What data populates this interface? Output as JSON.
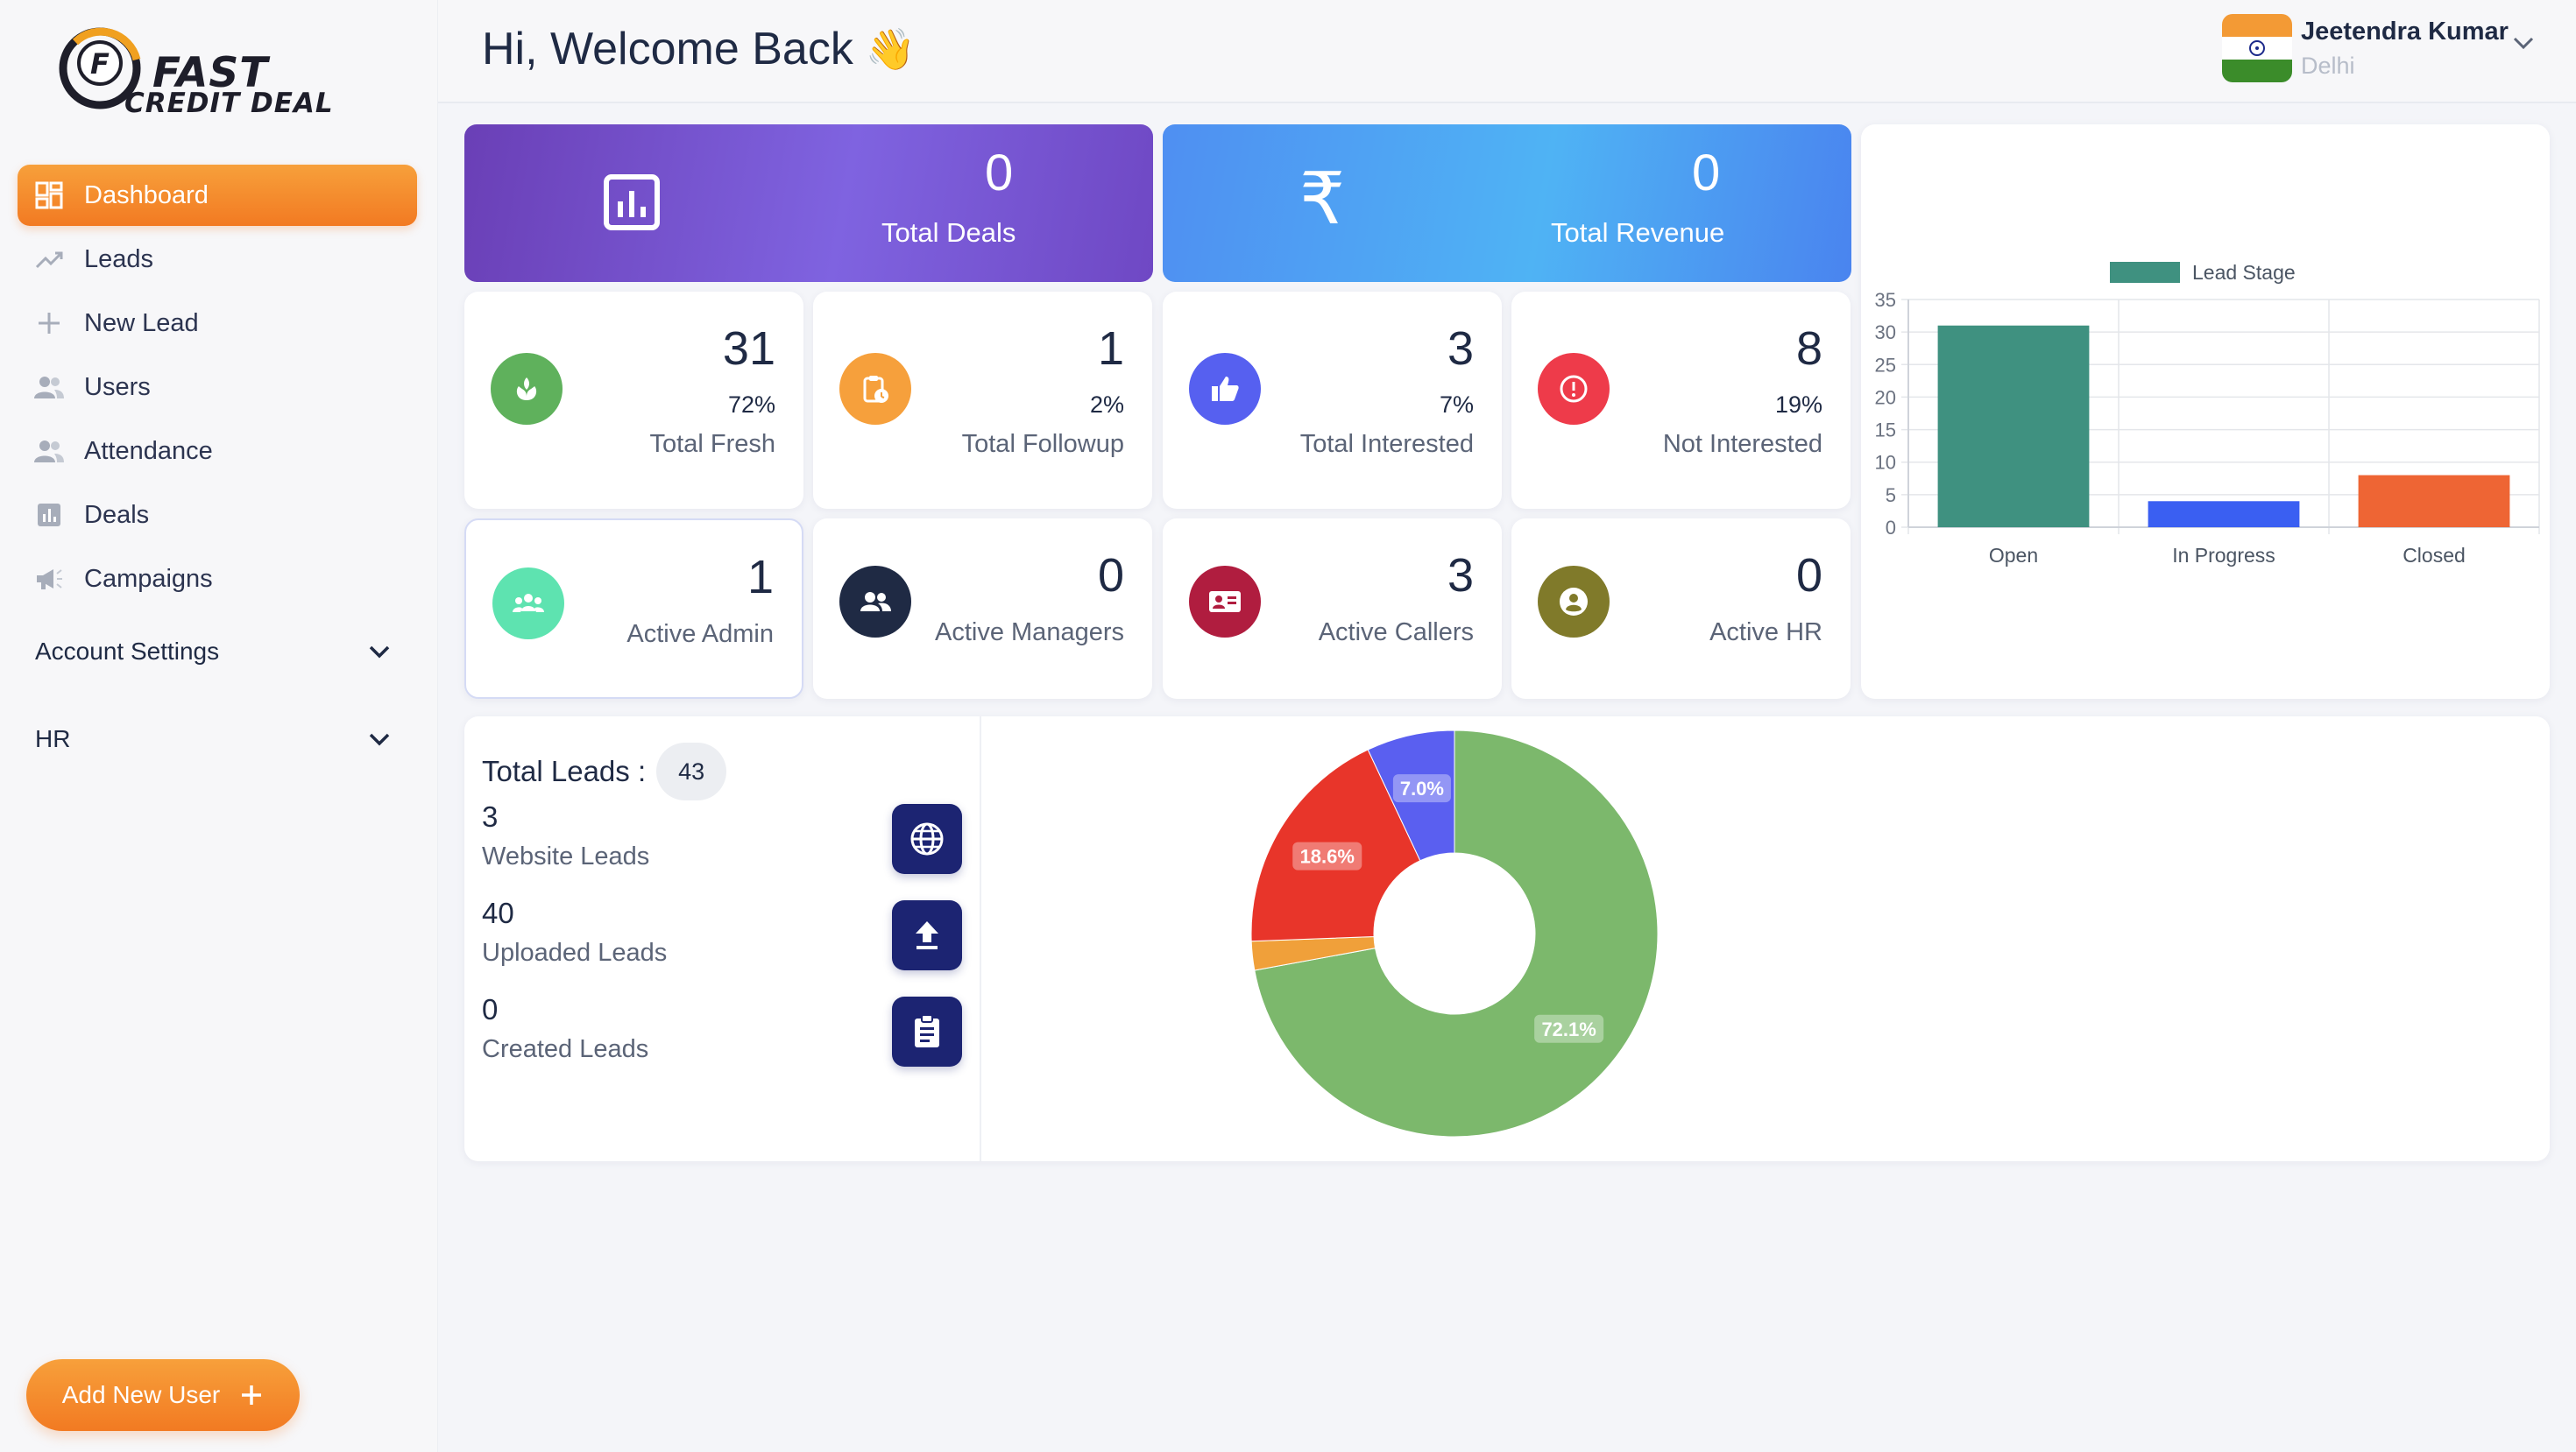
{
  "brand": {
    "logo_letter": "F",
    "line1": "FAST",
    "line2": "CREDIT DEAL"
  },
  "sidebar": {
    "items": [
      {
        "label": "Dashboard",
        "icon": "dashboard-icon",
        "active": true
      },
      {
        "label": "Leads",
        "icon": "trending-icon"
      },
      {
        "label": "New Lead",
        "icon": "plus-icon"
      },
      {
        "label": "Users",
        "icon": "users-icon"
      },
      {
        "label": "Attendance",
        "icon": "attendance-icon"
      },
      {
        "label": "Deals",
        "icon": "bar-chart-icon"
      },
      {
        "label": "Campaigns",
        "icon": "megaphone-icon"
      }
    ],
    "sections": [
      {
        "label": "Account Settings"
      },
      {
        "label": "HR"
      }
    ],
    "add_user_label": "Add New User"
  },
  "header": {
    "welcome": "Hi, Welcome Back",
    "wave_emoji": "👋",
    "user_name": "Jeetendra Kumar",
    "user_city": "Delhi"
  },
  "summary": {
    "deals": {
      "value": "0",
      "label": "Total Deals"
    },
    "revenue": {
      "value": "0",
      "label": "Total Revenue",
      "currency_symbol": "₹"
    }
  },
  "stats_row1": [
    {
      "value": "31",
      "pct": "72%",
      "label": "Total Fresh",
      "color": "#5fb15c",
      "icon": "sprout-icon"
    },
    {
      "value": "1",
      "pct": "2%",
      "label": "Total Followup",
      "color": "#f6a03c",
      "icon": "clipboard-clock-icon"
    },
    {
      "value": "3",
      "pct": "7%",
      "label": "Total Interested",
      "color": "#5660f0",
      "icon": "thumbs-up-icon"
    },
    {
      "value": "8",
      "pct": "19%",
      "label": "Not Interested",
      "color": "#ee3b4a",
      "icon": "alert-icon"
    }
  ],
  "stats_row2": [
    {
      "value": "1",
      "label": "Active Admin",
      "color": "#5ee3b0",
      "icon": "group-icon"
    },
    {
      "value": "0",
      "label": "Active Managers",
      "color": "#1f2a44",
      "icon": "people-icon"
    },
    {
      "value": "3",
      "label": "Active Callers",
      "color": "#b01d3f",
      "icon": "contact-card-icon"
    },
    {
      "value": "0",
      "label": "Active HR",
      "color": "#807a2a",
      "icon": "account-circle-icon"
    }
  ],
  "bar_chart": {
    "chart_data": {
      "type": "bar",
      "categories": [
        "Open",
        "In Progress",
        "Closed"
      ],
      "series": [
        {
          "name": "Lead Stage",
          "values": [
            31,
            4,
            8
          ]
        }
      ],
      "bar_colors": [
        "#3f9180",
        "#3a5ff2",
        "#ee6534"
      ],
      "ylim": [
        0,
        35
      ],
      "yticks": [
        "0",
        "5",
        "10",
        "15",
        "20",
        "25",
        "30",
        "35"
      ],
      "grid": true,
      "legend": "top"
    }
  },
  "leads": {
    "title": "Total Leads :",
    "total": "43",
    "rows": [
      {
        "value": "3",
        "label": "Website Leads",
        "icon": "globe-icon"
      },
      {
        "value": "40",
        "label": "Uploaded Leads",
        "icon": "upload-icon"
      },
      {
        "value": "0",
        "label": "Created Leads",
        "icon": "clipboard-icon"
      }
    ]
  },
  "donut_chart": {
    "chart_data": {
      "type": "pie",
      "values": [
        72.1,
        2.3,
        18.6,
        7.0
      ],
      "labels": [
        "72.1%",
        "",
        "18.6%",
        "7.0%"
      ],
      "colors": [
        "#7cb86c",
        "#f0a03a",
        "#e8352a",
        "#5a5ff0"
      ]
    }
  }
}
